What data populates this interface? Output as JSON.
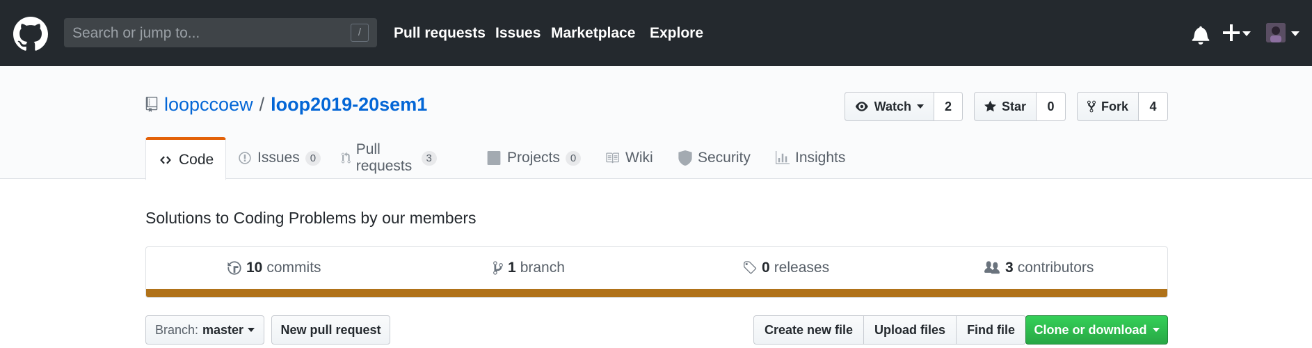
{
  "header": {
    "logo_icon": "github-octocat-icon",
    "search_placeholder": "Search or jump to...",
    "search_shortcut": "/",
    "nav": [
      "Pull requests",
      "Issues",
      "Marketplace",
      "Explore"
    ],
    "bell_icon": "bell-icon",
    "plus_icon": "plus-icon",
    "avatar_icon": "user-avatar"
  },
  "repo": {
    "owner": "loopccoew",
    "separator": "/",
    "name": "loop2019-20sem1",
    "watch": {
      "label": "Watch",
      "count": "2"
    },
    "star": {
      "label": "Star",
      "count": "0"
    },
    "fork": {
      "label": "Fork",
      "count": "4"
    }
  },
  "tabs": [
    {
      "label": "Code",
      "icon": "code-icon",
      "selected": true
    },
    {
      "label": "Issues",
      "icon": "issue-opened-icon",
      "counter": "0"
    },
    {
      "label": "Pull requests",
      "icon": "git-pull-request-icon",
      "counter": "3"
    },
    {
      "label": "Projects",
      "icon": "project-icon",
      "counter": "0"
    },
    {
      "label": "Wiki",
      "icon": "book-icon"
    },
    {
      "label": "Security",
      "icon": "shield-icon"
    },
    {
      "label": "Insights",
      "icon": "graph-icon"
    }
  ],
  "description": "Solutions to Coding Problems by our members",
  "summary": {
    "commits": {
      "num": "10",
      "label": "commits"
    },
    "branch": {
      "num": "1",
      "label": "branch"
    },
    "releases": {
      "num": "0",
      "label": "releases"
    },
    "contributors": {
      "num": "3",
      "label": "contributors"
    },
    "language_color": "#b07219"
  },
  "actions": {
    "branch_prefix": "Branch:",
    "branch_name": "master",
    "new_pr": "New pull request",
    "create_file": "Create new file",
    "upload_files": "Upload files",
    "find_file": "Find file",
    "clone": "Clone or download"
  },
  "colors": {
    "header_bg": "#24292e",
    "link": "#0366d6",
    "tab_accent": "#e36209",
    "clone_green": "#28a745"
  }
}
